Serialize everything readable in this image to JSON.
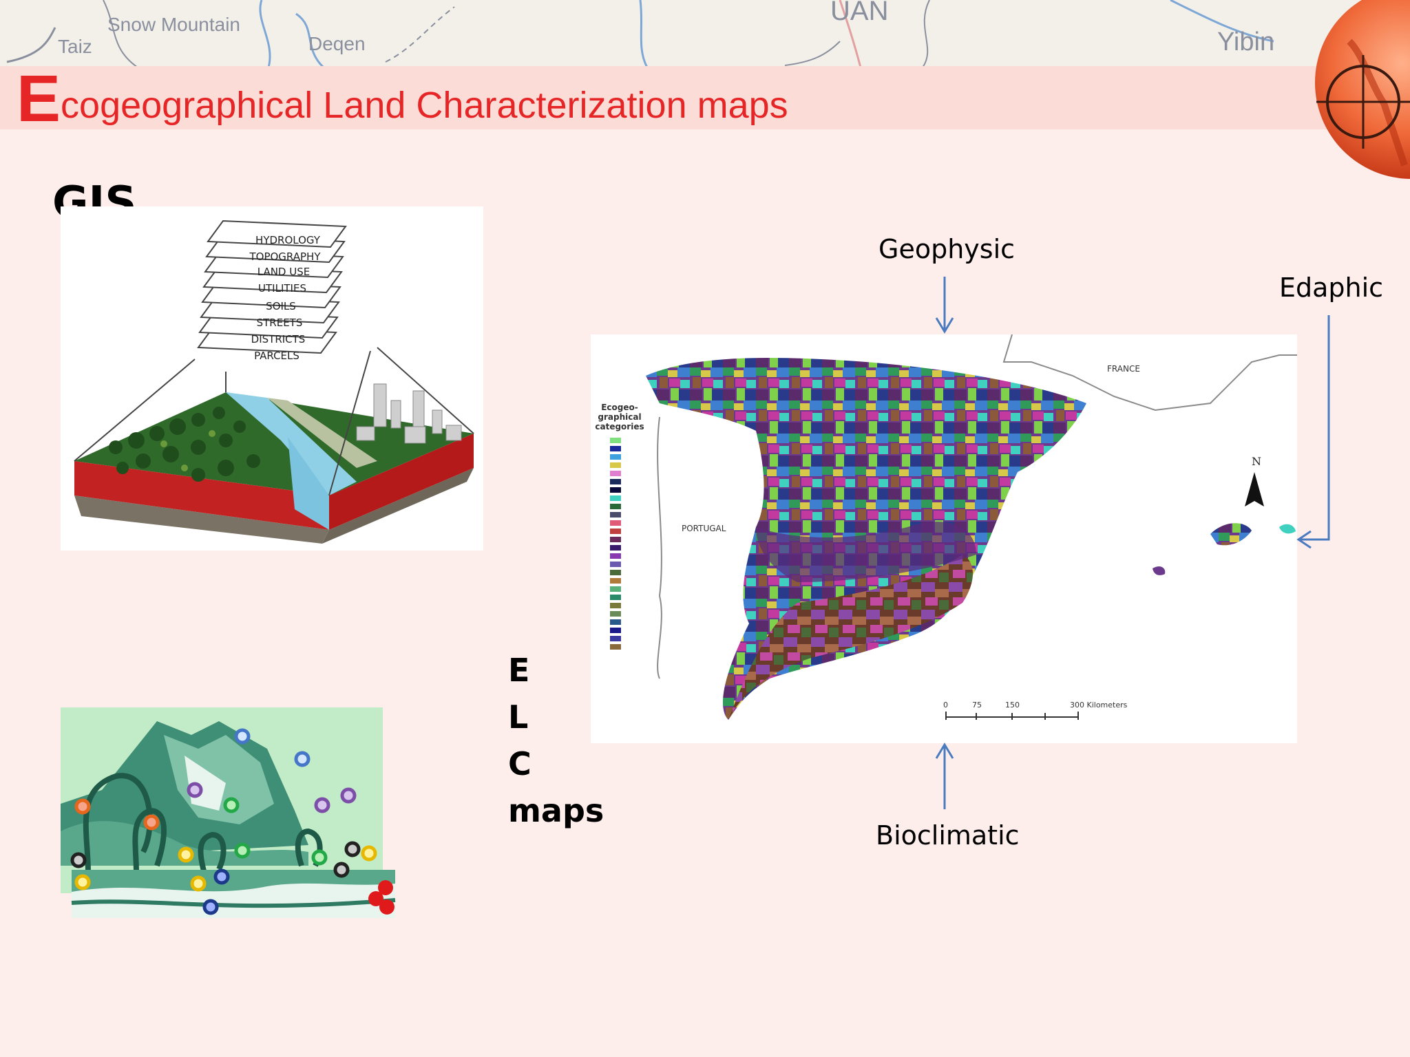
{
  "slide": {
    "title_initial": "E",
    "title_rest": "cogeographical Land Characterization maps",
    "title_color": "#e62626",
    "background_color": "#fdeeec"
  },
  "banner_map": {
    "labels": [
      "Taiz",
      "Snow Mountain",
      "Deqen",
      "UAN",
      "Yibin"
    ]
  },
  "gis": {
    "label": "GIS",
    "layers": [
      "HYDROLOGY",
      "TOPOGRAPHY",
      "LAND USE",
      "UTILITIES",
      "SOILS",
      "STREETS",
      "DISTRICTS",
      "PARCELS"
    ]
  },
  "elc": {
    "lines": [
      "E",
      "L",
      "C",
      "maps"
    ]
  },
  "map": {
    "legend_title_lines": [
      "Ecogeo-",
      "graphical",
      "categories"
    ],
    "country_labels": [
      "FRANCE",
      "PORTUGAL"
    ],
    "north_label": "N",
    "scale_labels": [
      "0",
      "75",
      "150",
      "300 Kilometers"
    ]
  },
  "annotations": {
    "top": "Geophysic",
    "right": "Edaphic",
    "bottom": "Bioclimatic",
    "arrow_color": "#4a7bbf"
  }
}
